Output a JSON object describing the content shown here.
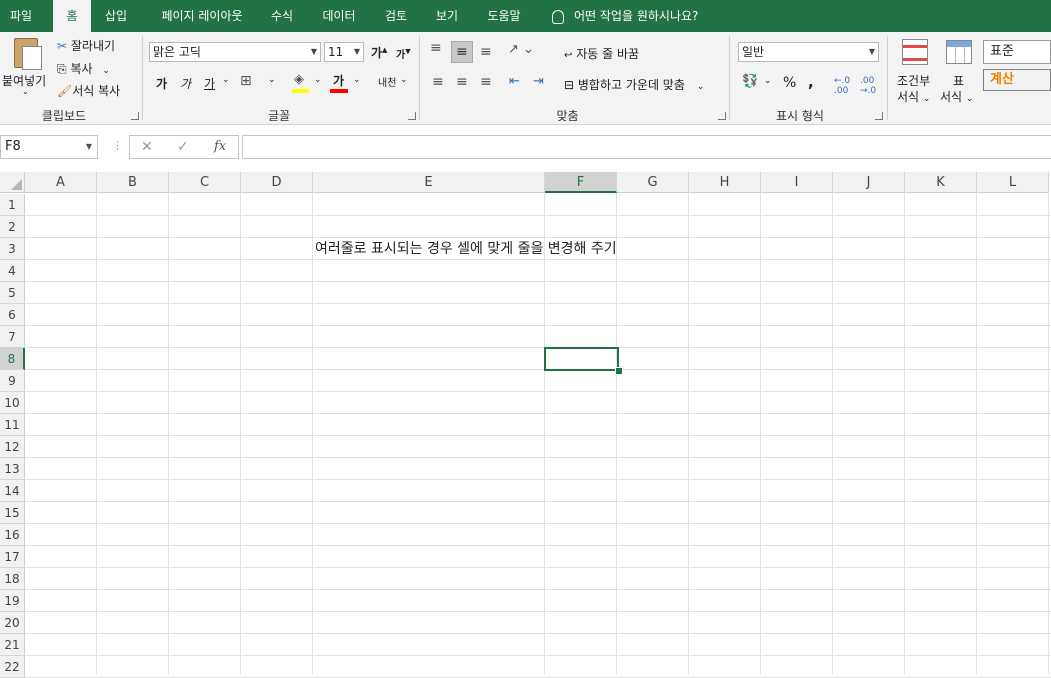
{
  "tabs": [
    "파일",
    "홈",
    "삽입",
    "페이지 레이아웃",
    "수식",
    "데이터",
    "검토",
    "보기",
    "도움말"
  ],
  "tell_me": "어떤 작업을 원하시나요?",
  "clipboard": {
    "paste": "붙여넣기",
    "cut": "잘라내기",
    "copy": "복사",
    "format_painter": "서식 복사",
    "label": "클립보드"
  },
  "font": {
    "name": "맑은 고딕",
    "size": "11",
    "grow": "가",
    "shrink": "가",
    "bold": "가",
    "italic": "가",
    "underline": "가",
    "color_glyph": "가",
    "phonetic": "내천",
    "label": "글꼴"
  },
  "alignment": {
    "wrap_text": "자동 줄 바꿈",
    "merge_center": "병합하고 가운데 맞춤",
    "label": "맞춤"
  },
  "number": {
    "format": "일반",
    "percent": "%",
    "comma": ",",
    "label": "표시 형식"
  },
  "styles": {
    "conditional_line1": "조건부",
    "conditional_line2": "서식",
    "table_line1": "표",
    "table_line2": "서식",
    "normal": "표준",
    "calculation": "계산"
  },
  "formula_bar": {
    "name_box": "F8",
    "cancel": "✕",
    "enter": "✓",
    "fx": "fx",
    "content": ""
  },
  "columns": [
    "A",
    "B",
    "C",
    "D",
    "E",
    "F",
    "G",
    "H",
    "I",
    "J",
    "K",
    "L"
  ],
  "rows": [
    "1",
    "2",
    "3",
    "4",
    "5",
    "6",
    "7",
    "8",
    "9",
    "10",
    "11",
    "12",
    "13",
    "14",
    "15",
    "16",
    "17",
    "18",
    "19",
    "20",
    "21",
    "22"
  ],
  "cells": {
    "E3": "여러줄로 표시되는 경우 셀에 맞게 줄을 변경해 주기"
  },
  "active_cell": "F8",
  "colors": {
    "accent": "#217346",
    "fill_color": "#ffff00",
    "font_color": "#ff0000",
    "calc_text": "#fa7d00"
  }
}
